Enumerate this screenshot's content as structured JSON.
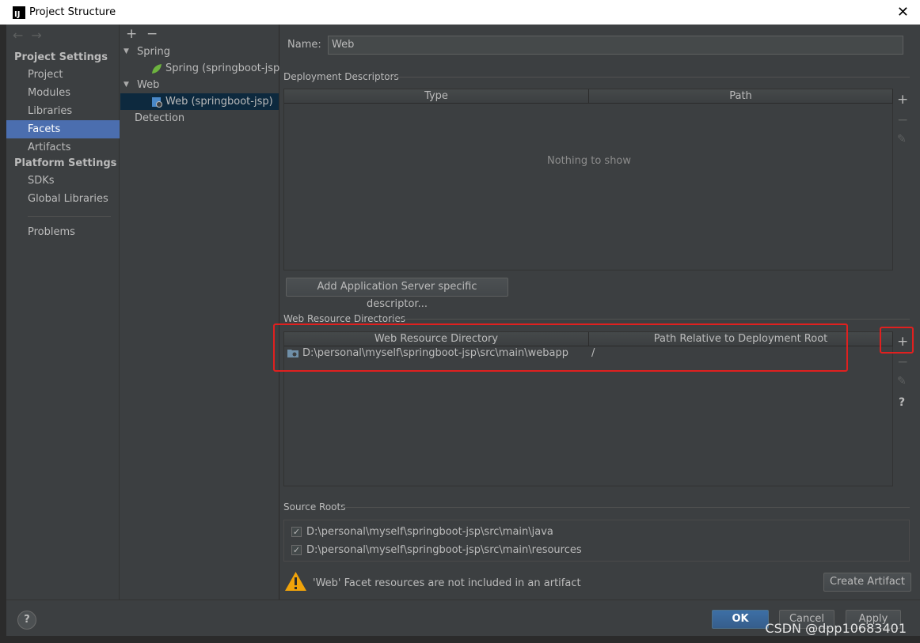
{
  "window": {
    "title": "Project Structure",
    "app_icon_letter": "IJ",
    "close_glyph": "✕"
  },
  "sidebar": {
    "nav_back": "←",
    "nav_forward": "→",
    "project_settings_header": "Project Settings",
    "items": [
      {
        "label": "Project"
      },
      {
        "label": "Modules"
      },
      {
        "label": "Libraries"
      },
      {
        "label": "Facets",
        "selected": true
      },
      {
        "label": "Artifacts"
      }
    ],
    "platform_settings_header": "Platform Settings",
    "platform_items": [
      {
        "label": "SDKs"
      },
      {
        "label": "Global Libraries"
      }
    ],
    "problems_label": "Problems"
  },
  "tree": {
    "add_glyph": "+",
    "remove_glyph": "−",
    "nodes": [
      {
        "label": "Spring",
        "expanded": true
      },
      {
        "label": "Spring (springboot-jsp)"
      },
      {
        "label": "Web",
        "expanded": true
      },
      {
        "label": "Web (springboot-jsp)",
        "selected": true
      },
      {
        "label": "Detection"
      }
    ]
  },
  "main": {
    "name_label": "Name:",
    "name_value": "Web",
    "deployment_descriptors": {
      "group_label": "Deployment Descriptors",
      "columns": [
        "Type",
        "Path"
      ],
      "empty_text": "Nothing to show",
      "add_server_button": "Add Application Server specific descriptor..."
    },
    "web_resource_directories": {
      "group_label": "Web Resource Directories",
      "columns": [
        "Web Resource Directory",
        "Path Relative to Deployment Root"
      ],
      "rows": [
        {
          "directory": "D:\\personal\\myself\\springboot-jsp\\src\\main\\webapp",
          "relative_path": "/"
        }
      ]
    },
    "side_tools": {
      "add": "+",
      "remove": "−",
      "edit": "✎",
      "help": "?"
    },
    "source_roots": {
      "group_label": "Source Roots",
      "items": [
        {
          "path": "D:\\personal\\myself\\springboot-jsp\\src\\main\\java",
          "checked": true
        },
        {
          "path": "D:\\personal\\myself\\springboot-jsp\\src\\main\\resources",
          "checked": true
        }
      ]
    },
    "warning": {
      "icon_glyph": "!",
      "text": "'Web' Facet resources are not included in an artifact",
      "create_artifact_button": "Create Artifact"
    }
  },
  "footer": {
    "help_glyph": "?",
    "ok_button": "OK",
    "cancel_button": "Cancel",
    "apply_button": "Apply",
    "watermark": "CSDN @dpp10683401"
  },
  "colors": {
    "selection": "#4b6eaf",
    "tree_selection": "#0d293e",
    "highlight_box": "#e0201f",
    "spring_leaf": "#6db33f",
    "warning": "#f0a30a"
  }
}
